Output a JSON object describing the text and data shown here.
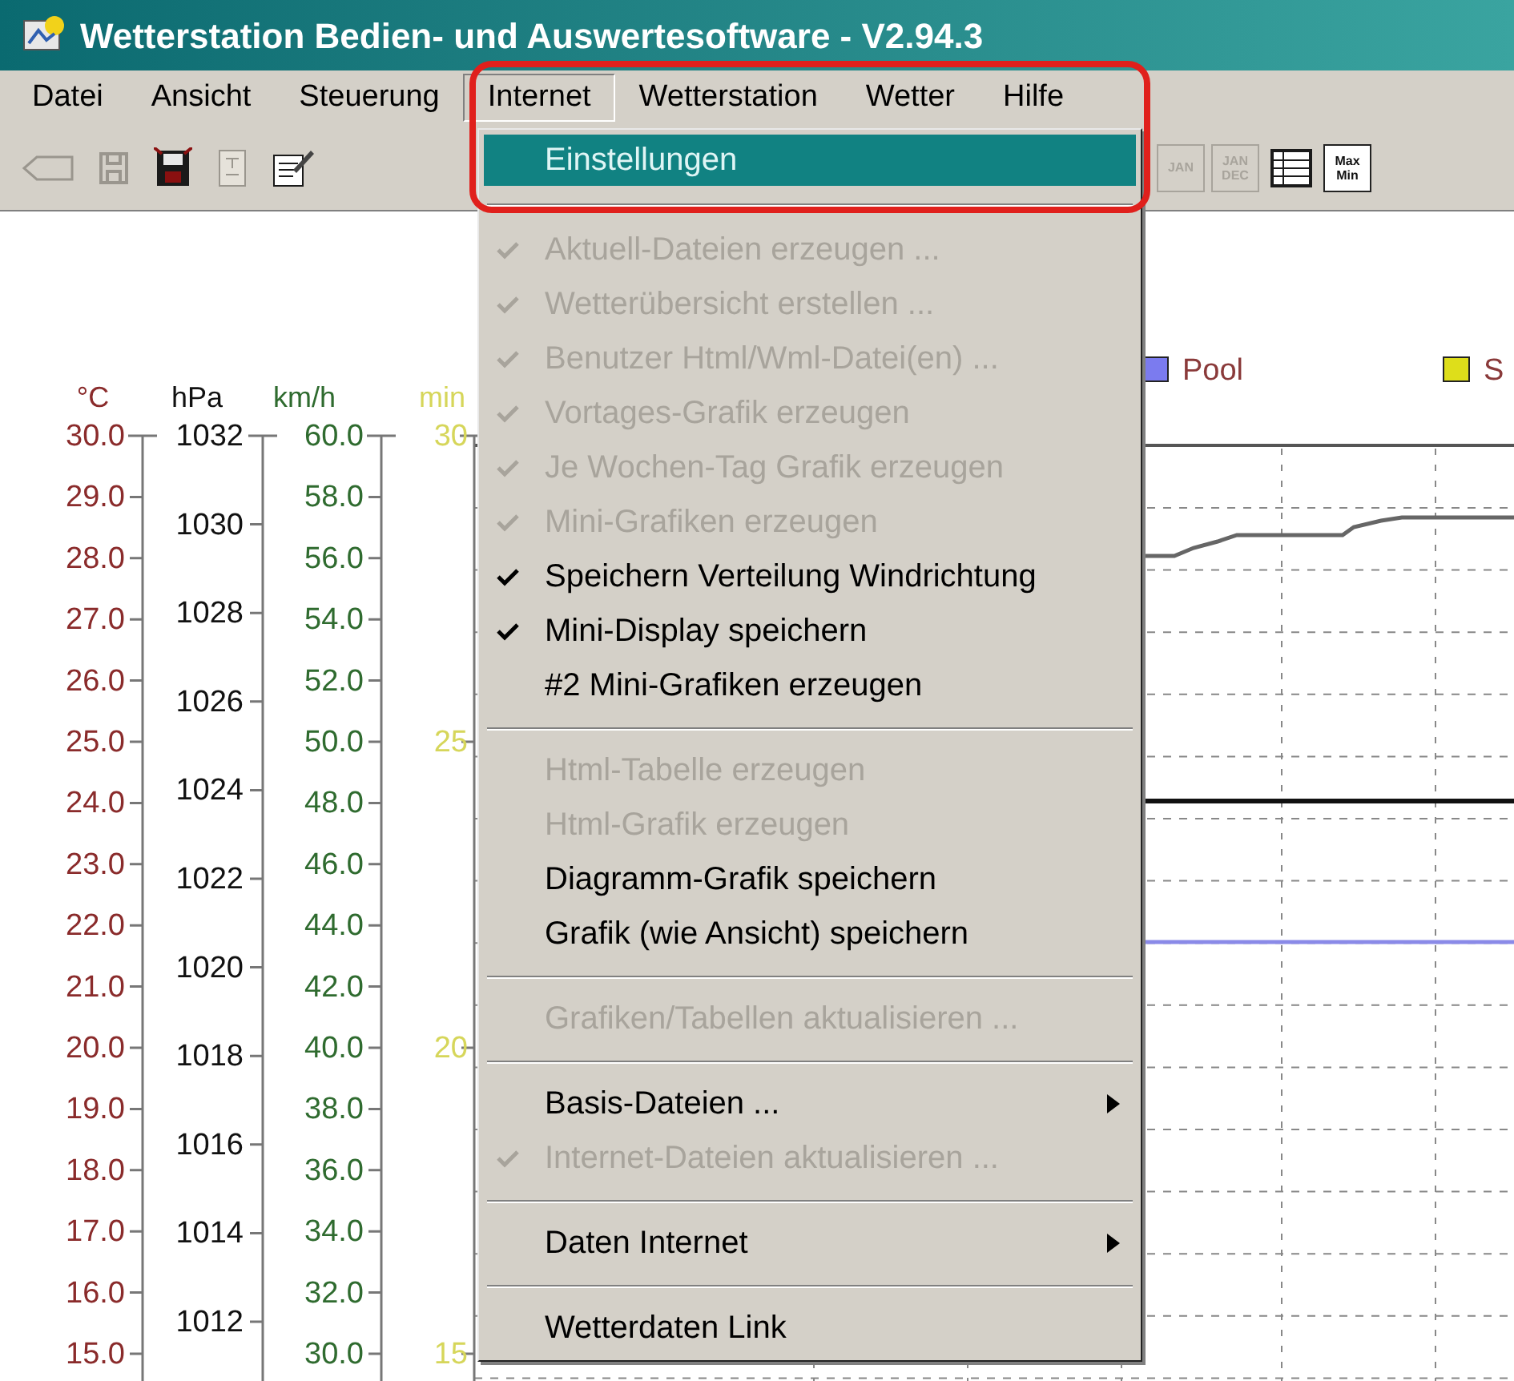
{
  "window": {
    "title": "Wetterstation Bedien- und Auswertesoftware - V2.94.3"
  },
  "menubar": [
    {
      "label": "Datei",
      "selected": false
    },
    {
      "label": "Ansicht",
      "selected": false
    },
    {
      "label": "Steuerung",
      "selected": false
    },
    {
      "label": "Internet",
      "selected": true
    },
    {
      "label": "Wetterstation",
      "selected": false
    },
    {
      "label": "Wetter",
      "selected": false
    },
    {
      "label": "Hilfe",
      "selected": false
    }
  ],
  "toolbar": [
    {
      "kind": "back",
      "disabled": true
    },
    {
      "kind": "save",
      "disabled": true
    },
    {
      "kind": "disk",
      "disabled": false
    },
    {
      "kind": "doc",
      "disabled": true
    },
    {
      "kind": "note",
      "disabled": false
    },
    {
      "kind": "month",
      "disabled": true,
      "label": "JAN"
    },
    {
      "kind": "year",
      "disabled": true,
      "label": "JAN DEC"
    },
    {
      "kind": "table",
      "disabled": false
    },
    {
      "kind": "maxmin",
      "disabled": false,
      "label": "Max Min"
    }
  ],
  "chart": {
    "axes": [
      {
        "kind": "fine",
        "unit": "°C",
        "color": "#8a2b2b",
        "ticks": [
          "30.0",
          "29.0",
          "28.0",
          "27.0",
          "26.0",
          "25.0",
          "24.0",
          "23.0",
          "22.0",
          "21.0",
          "20.0",
          "19.0",
          "18.0",
          "17.0",
          "16.0",
          "15.0"
        ]
      },
      {
        "kind": "pressure",
        "unit": "hPa",
        "color": "#111111",
        "ticks": [
          "1032",
          "1030",
          "1028",
          "1026",
          "1024",
          "1022",
          "1020",
          "1018",
          "1016",
          "1014",
          "1012"
        ]
      },
      {
        "kind": "fine",
        "unit": "km/h",
        "color": "#2f6b2f",
        "ticks": [
          "60.0",
          "58.0",
          "56.0",
          "54.0",
          "52.0",
          "50.0",
          "48.0",
          "46.0",
          "44.0",
          "42.0",
          "40.0",
          "38.0",
          "36.0",
          "34.0",
          "32.0",
          "30.0"
        ]
      },
      {
        "kind": "coarse",
        "unit": "min",
        "color": "#d6d65a",
        "ticks": [
          "30",
          "25",
          "20",
          "15"
        ]
      }
    ],
    "legend": [
      {
        "label": "Pool",
        "color": "#7b7bef"
      },
      {
        "label": "S",
        "color": "#dede1a"
      }
    ]
  },
  "menu": [
    {
      "kind": "item",
      "label": "Einstellungen",
      "selected": true,
      "checked": false,
      "disabled": false,
      "submenu": false
    },
    {
      "kind": "separator"
    },
    {
      "kind": "item",
      "label": "Aktuell-Dateien erzeugen ...",
      "selected": false,
      "checked": true,
      "disabled": true,
      "submenu": false
    },
    {
      "kind": "item",
      "label": "Wetterübersicht erstellen ...",
      "selected": false,
      "checked": true,
      "disabled": true,
      "submenu": false
    },
    {
      "kind": "item",
      "label": "Benutzer Html/Wml-Datei(en) ...",
      "selected": false,
      "checked": true,
      "disabled": true,
      "submenu": false
    },
    {
      "kind": "item",
      "label": "Vortages-Grafik erzeugen",
      "selected": false,
      "checked": true,
      "disabled": true,
      "submenu": false
    },
    {
      "kind": "item",
      "label": "Je Wochen-Tag Grafik erzeugen",
      "selected": false,
      "checked": true,
      "disabled": true,
      "submenu": false
    },
    {
      "kind": "item",
      "label": "Mini-Grafiken erzeugen",
      "selected": false,
      "checked": true,
      "disabled": true,
      "submenu": false
    },
    {
      "kind": "item",
      "label": "Speichern Verteilung Windrichtung",
      "selected": false,
      "checked": true,
      "disabled": false,
      "submenu": false
    },
    {
      "kind": "item",
      "label": "Mini-Display speichern",
      "selected": false,
      "checked": true,
      "disabled": false,
      "submenu": false
    },
    {
      "kind": "item",
      "label": "#2 Mini-Grafiken erzeugen",
      "selected": false,
      "checked": false,
      "disabled": false,
      "submenu": false
    },
    {
      "kind": "separator"
    },
    {
      "kind": "item",
      "label": "Html-Tabelle erzeugen",
      "selected": false,
      "checked": false,
      "disabled": true,
      "submenu": false
    },
    {
      "kind": "item",
      "label": "Html-Grafik erzeugen",
      "selected": false,
      "checked": false,
      "disabled": true,
      "submenu": false
    },
    {
      "kind": "item",
      "label": "Diagramm-Grafik speichern",
      "selected": false,
      "checked": false,
      "disabled": false,
      "submenu": false
    },
    {
      "kind": "item",
      "label": "Grafik (wie Ansicht) speichern",
      "selected": false,
      "checked": false,
      "disabled": false,
      "submenu": false
    },
    {
      "kind": "separator"
    },
    {
      "kind": "item",
      "label": "Grafiken/Tabellen aktualisieren ...",
      "selected": false,
      "checked": false,
      "disabled": true,
      "submenu": false
    },
    {
      "kind": "separator"
    },
    {
      "kind": "item",
      "label": "Basis-Dateien ...",
      "selected": false,
      "checked": false,
      "disabled": false,
      "submenu": true
    },
    {
      "kind": "item",
      "label": "Internet-Dateien aktualisieren ...",
      "selected": false,
      "checked": true,
      "disabled": true,
      "submenu": false
    },
    {
      "kind": "separator"
    },
    {
      "kind": "item",
      "label": "Daten Internet",
      "selected": false,
      "checked": false,
      "disabled": false,
      "submenu": true
    },
    {
      "kind": "separator"
    },
    {
      "kind": "item",
      "label": "Wetterdaten Link",
      "selected": false,
      "checked": false,
      "disabled": false,
      "submenu": false
    }
  ]
}
